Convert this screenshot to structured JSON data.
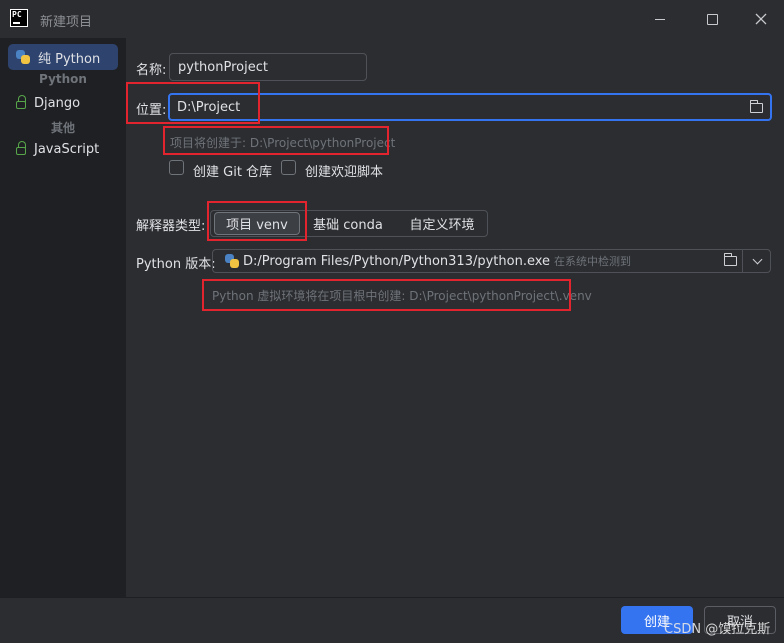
{
  "window": {
    "app_icon_text": "PC",
    "title": "新建项目"
  },
  "sidebar": {
    "items": [
      {
        "label": "纯 Python",
        "icon": "python-icon",
        "selected": true
      },
      {
        "label": "Django",
        "icon": "lock-icon"
      },
      {
        "label": "JavaScript",
        "icon": "lock-icon"
      }
    ],
    "groups": [
      "Python",
      "其他"
    ]
  },
  "form": {
    "name_label": "名称:",
    "name_value": "pythonProject",
    "location_label": "位置:",
    "location_value": "D:\\Project",
    "location_hint": "项目将创建于: D:\\Project\\pythonProject",
    "git_checkbox_label": "创建 Git 仓库",
    "welcome_checkbox_label": "创建欢迎脚本",
    "interpreter_label": "解释器类型:",
    "interpreter_options": [
      "项目 venv",
      "基础 conda",
      "自定义环境"
    ],
    "interpreter_selected": "项目 venv",
    "python_version_label": "Python 版本:",
    "python_path": "D:/Program Files/Python/Python313/python.exe",
    "python_detected": "在系统中检测到",
    "venv_hint": "Python 虚拟环境将在项目根中创建: D:\\Project\\pythonProject\\.venv"
  },
  "footer": {
    "create_label": "创建",
    "cancel_label": "取消"
  },
  "watermark": "CSDN @馍拉克斯",
  "colors": {
    "accent": "#3574f0",
    "highlight_box": "#e1242d",
    "selected_item": "#2e436e"
  }
}
